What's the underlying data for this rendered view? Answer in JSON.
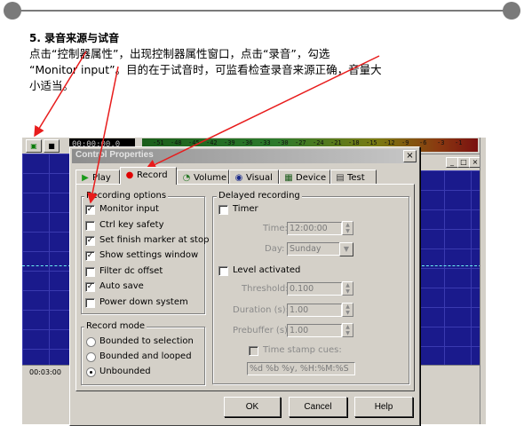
{
  "instruction": {
    "title": "5. 录音来源与试音",
    "line1": "点击“控制器属性”，出现控制器属性窗口，点击“录音”，勾选",
    "line2": "“Monitor input”。目的在于试音时，可监看检查录音来源正确，音量大",
    "line3": "小适当。"
  },
  "app": {
    "counter": "00:00:00.0",
    "meter_ticks": [
      "-51",
      "-48",
      "-45",
      "-42",
      "-39",
      "-36",
      "-33",
      "-30",
      "-27",
      "-24",
      "-21",
      "-18",
      "-15",
      "-12",
      "-9",
      "-6",
      "-3",
      "-1"
    ],
    "ruler_time": "00:03:00"
  },
  "dialog": {
    "title": "Control Properties",
    "close": "×",
    "tabs": [
      {
        "label": "Play",
        "icon": "play-icon",
        "active": false
      },
      {
        "label": "Record",
        "icon": "record-icon",
        "active": true
      },
      {
        "label": "Volume",
        "icon": "volume-icon",
        "active": false
      },
      {
        "label": "Visual",
        "icon": "visual-eye-icon",
        "active": false
      },
      {
        "label": "Device",
        "icon": "device-icon",
        "active": false
      },
      {
        "label": "Test",
        "icon": "test-icon",
        "active": false
      }
    ],
    "recording_options": {
      "label": "Recording options",
      "items": [
        {
          "label": "Monitor input",
          "checked": true
        },
        {
          "label": "Ctrl key safety",
          "checked": false
        },
        {
          "label": "Set finish marker at stop",
          "checked": true
        },
        {
          "label": "Show settings window",
          "checked": true
        },
        {
          "label": "Filter dc offset",
          "checked": false
        },
        {
          "label": "Auto save",
          "checked": true
        },
        {
          "label": "Power down system",
          "checked": false
        }
      ]
    },
    "record_mode": {
      "label": "Record mode",
      "items": [
        {
          "label": "Bounded to selection",
          "selected": false
        },
        {
          "label": "Bounded and looped",
          "selected": false
        },
        {
          "label": "Unbounded",
          "selected": true
        }
      ]
    },
    "delayed_recording": {
      "label": "Delayed recording",
      "timer_label": "Timer",
      "time_label": "Time:",
      "time_value": "12:00:00",
      "day_label": "Day:",
      "day_value": "Sunday",
      "level_label": "Level activated",
      "threshold_label": "Threshold:",
      "threshold_value": "0.100",
      "duration_label": "Duration (s):",
      "duration_value": "1.00",
      "prebuffer_label": "Prebuffer (s):",
      "prebuffer_value": "1.00",
      "timestamp_label": "Time stamp cues:",
      "timestamp_value": "%d %b %y, %H:%M:%S"
    },
    "buttons": {
      "ok": "OK",
      "cancel": "Cancel",
      "help": "Help"
    }
  },
  "colors": {
    "arrow": "#e81c1c",
    "title_start": "#8d8d8d",
    "title_end": "#c6c6c6",
    "wave_bg": "#1a1a8c"
  }
}
